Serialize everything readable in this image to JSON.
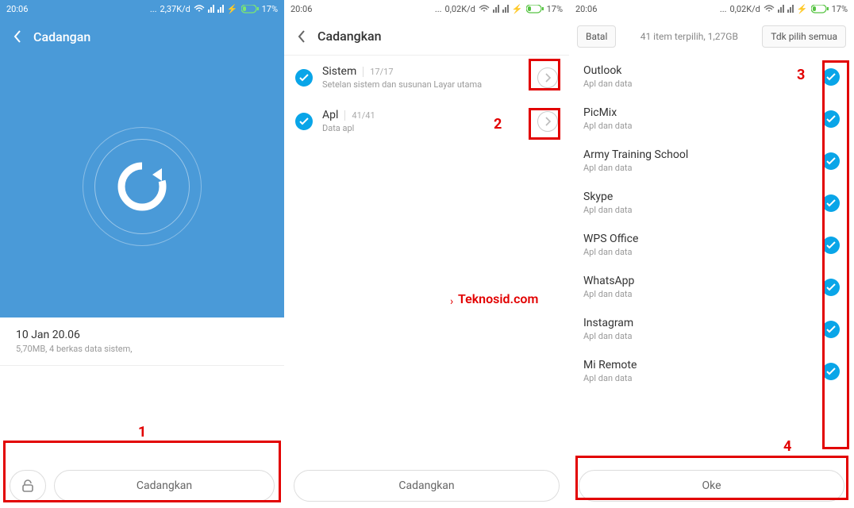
{
  "status": {
    "time": "20:06",
    "net": "0,02K/d",
    "net1": "2,37K/d",
    "battery": "17%"
  },
  "screen1": {
    "title": "Cadangan",
    "info_title": "10 Jan 20.06",
    "info_sub": "5,70MB, 4 berkas data sistem,",
    "btn": "Cadangkan",
    "anno1": "1"
  },
  "screen2": {
    "title": "Cadangkan",
    "sistem": {
      "label": "Sistem",
      "count": "17/17",
      "sub": "Setelan sistem dan susunan Layar utama"
    },
    "apl": {
      "label": "Apl",
      "count": "41/41",
      "sub": "Data apl"
    },
    "btn": "Cadangkan",
    "anno2": "2",
    "watermark": "Teknosid.com"
  },
  "screen3": {
    "cancel": "Batal",
    "selected": "41 item terpilih, 1,27GB",
    "deselect": "Tdk pilih semua",
    "apps": [
      {
        "name": "Outlook",
        "sub": "Apl dan data"
      },
      {
        "name": "PicMix",
        "sub": "Apl dan data"
      },
      {
        "name": "Army Training School",
        "sub": "Apl dan data"
      },
      {
        "name": "Skype",
        "sub": "Apl dan data"
      },
      {
        "name": "WPS Office",
        "sub": "Apl dan data"
      },
      {
        "name": "WhatsApp",
        "sub": "Apl dan data"
      },
      {
        "name": "Instagram",
        "sub": "Apl dan data"
      },
      {
        "name": "Mi Remote",
        "sub": "Apl dan data"
      }
    ],
    "ok": "Oke",
    "anno3": "3",
    "anno4": "4"
  }
}
